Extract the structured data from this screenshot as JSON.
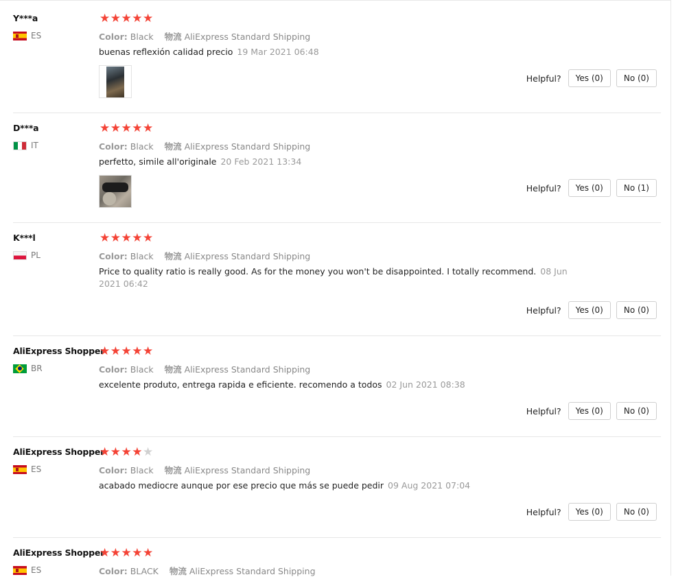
{
  "helpful_label": "Helpful?",
  "reviews": [
    {
      "user": "Y***a",
      "country": "ES",
      "rating": 5,
      "color_label": "Color:",
      "color": "Black",
      "ship_label": "物流",
      "shipping": "AliExpress Standard Shipping",
      "text": "buenas reflexión calidad precio",
      "date": "19 Mar 2021 06:48",
      "yes": "Yes (0)",
      "no": "No (0)",
      "has_image": true
    },
    {
      "user": "D***a",
      "country": "IT",
      "rating": 5,
      "color_label": "Color:",
      "color": "Black",
      "ship_label": "物流",
      "shipping": "AliExpress Standard Shipping",
      "text": "perfetto, simile all'originale",
      "date": "20 Feb 2021 13:34",
      "yes": "Yes (0)",
      "no": "No (1)",
      "has_image": true
    },
    {
      "user": "K***l",
      "country": "PL",
      "rating": 5,
      "color_label": "Color:",
      "color": "Black",
      "ship_label": "物流",
      "shipping": "AliExpress Standard Shipping",
      "text": "Price to quality ratio is really good. As for the money you won't be disappointed. I totally recommend.",
      "date": "08 Jun 2021 06:42",
      "yes": "Yes (0)",
      "no": "No (0)",
      "has_image": false
    },
    {
      "user": "AliExpress Shopper",
      "country": "BR",
      "rating": 5,
      "color_label": "Color:",
      "color": "Black",
      "ship_label": "物流",
      "shipping": "AliExpress Standard Shipping",
      "text": "excelente produto, entrega rapida e eficiente. recomendo a todos",
      "date": "02 Jun 2021 08:38",
      "yes": "Yes (0)",
      "no": "No (0)",
      "has_image": false
    },
    {
      "user": "AliExpress Shopper",
      "country": "ES",
      "rating": 4,
      "color_label": "Color:",
      "color": "Black",
      "ship_label": "物流",
      "shipping": "AliExpress Standard Shipping",
      "text": "acabado mediocre aunque por ese precio que más se puede pedir",
      "date": "09 Aug 2021 07:04",
      "yes": "Yes (0)",
      "no": "No (0)",
      "has_image": false
    },
    {
      "user": "AliExpress Shopper",
      "country": "ES",
      "rating": 5,
      "color_label": "Color:",
      "color": "BLACK",
      "ship_label": "物流",
      "shipping": "AliExpress Standard Shipping"
    }
  ]
}
